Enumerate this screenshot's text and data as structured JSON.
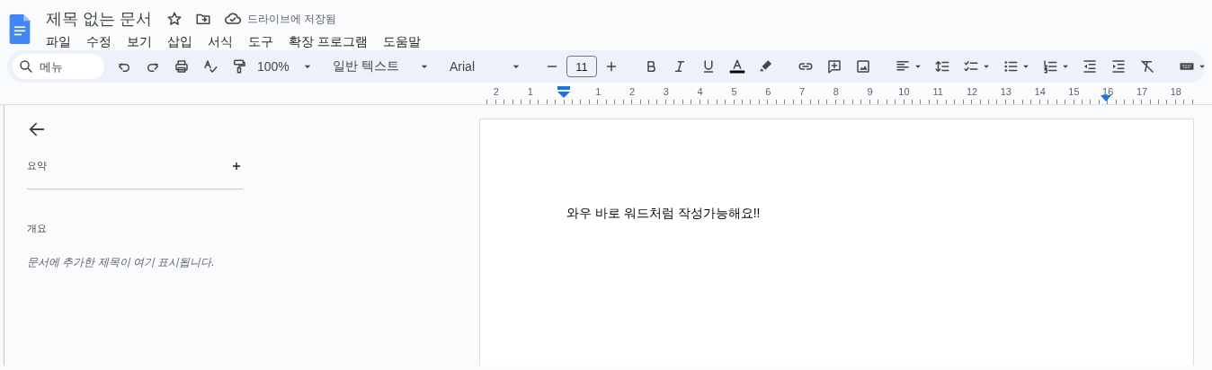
{
  "document": {
    "title": "제목 없는 문서",
    "save_status": "드라이브에 저장됨"
  },
  "menu": [
    "파일",
    "수정",
    "보기",
    "삽입",
    "서식",
    "도구",
    "확장 프로그램",
    "도움말"
  ],
  "toolbar": {
    "search": {
      "placeholder": "메뉴"
    },
    "zoom": "100%",
    "style": "일반 텍스트",
    "font": "Arial",
    "font_size": "11"
  },
  "ruler": {
    "left_labels": [
      "2",
      "1"
    ],
    "right_labels": [
      "1",
      "2",
      "3",
      "4",
      "5",
      "6",
      "7",
      "8",
      "9",
      "10",
      "11",
      "12",
      "13",
      "14",
      "15",
      "16",
      "17",
      "18"
    ]
  },
  "sidebar": {
    "summary_label": "요약",
    "outline_label": "개요",
    "outline_hint": "문서에 추가한 제목이 여기 표시됩니다."
  },
  "page": {
    "text": "와우 바로 워드처럼 작성가능해요!!"
  }
}
